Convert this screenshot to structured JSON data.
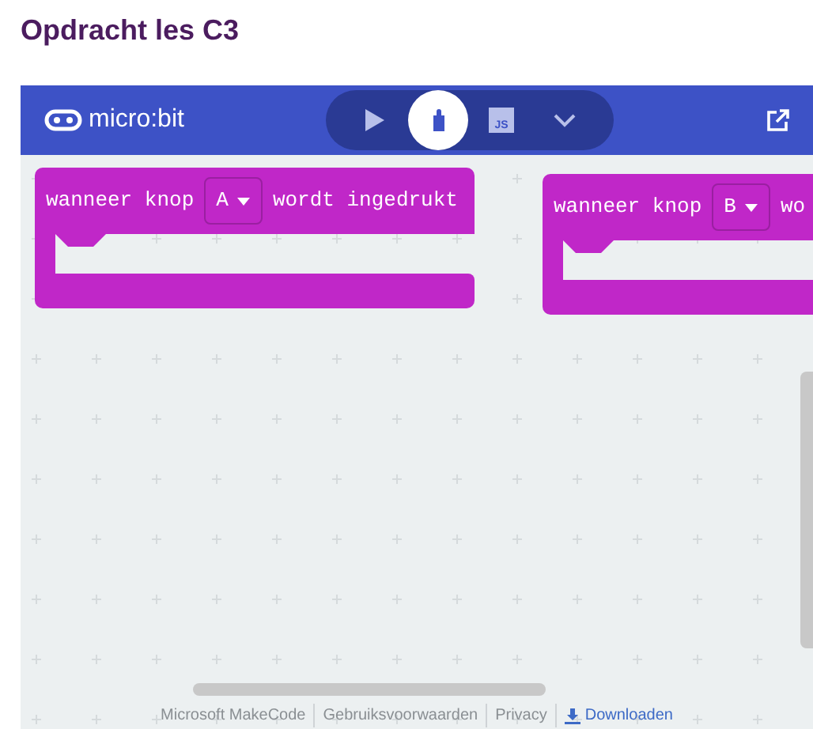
{
  "page_title": "Opdracht les C3",
  "editor": {
    "brand": "micro:bit",
    "modes": [
      {
        "kind": "play",
        "selected": false
      },
      {
        "kind": "blocks",
        "selected": true
      },
      {
        "kind": "js",
        "label": "JS",
        "selected": false
      },
      {
        "kind": "more",
        "selected": false
      }
    ],
    "blocks": [
      {
        "before": "wanneer knop",
        "button": "A",
        "after": "wordt ingedrukt"
      },
      {
        "before": "wanneer knop",
        "button": "B",
        "after": "wo"
      }
    ],
    "footer": [
      {
        "kind": "text",
        "label": "Microsoft MakeCode"
      },
      {
        "kind": "text",
        "label": "Gebruiksvoorwaarden"
      },
      {
        "kind": "text",
        "label": "Privacy"
      },
      {
        "kind": "download",
        "label": "Downloaden"
      }
    ]
  }
}
